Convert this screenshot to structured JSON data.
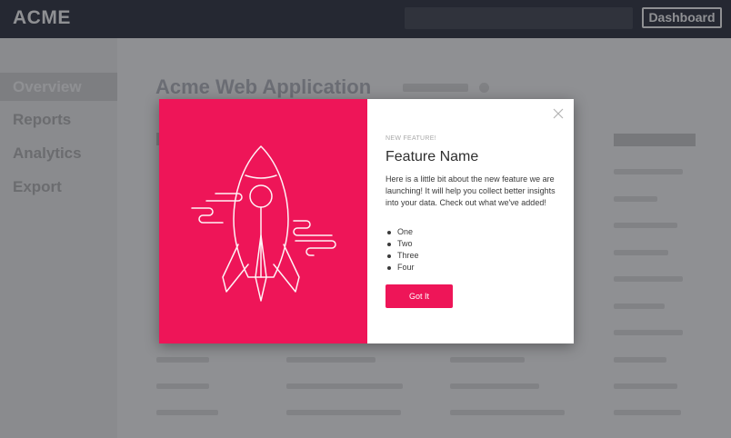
{
  "app": {
    "logo": "ACME",
    "dashboard_label": "Dashboard"
  },
  "sidebar": {
    "items": [
      {
        "label": "Overview",
        "active": true
      },
      {
        "label": "Reports"
      },
      {
        "label": "Analytics"
      },
      {
        "label": "Export"
      }
    ]
  },
  "main": {
    "title": "Acme Web Application"
  },
  "modal": {
    "eyebrow": "NEW FEATURE!",
    "title": "Feature Name",
    "description": "Here is a little bit about the new feature we are launching! It will help you collect better insights into your data. Check out what we've added!",
    "items": [
      "One",
      "Two",
      "Three",
      "Four"
    ],
    "cta_label": "Got It",
    "close_icon": "close-icon",
    "illustration_icon": "rocket-icon"
  },
  "colors": {
    "accent": "#ee1558",
    "topbar": "#3b3f4c"
  }
}
